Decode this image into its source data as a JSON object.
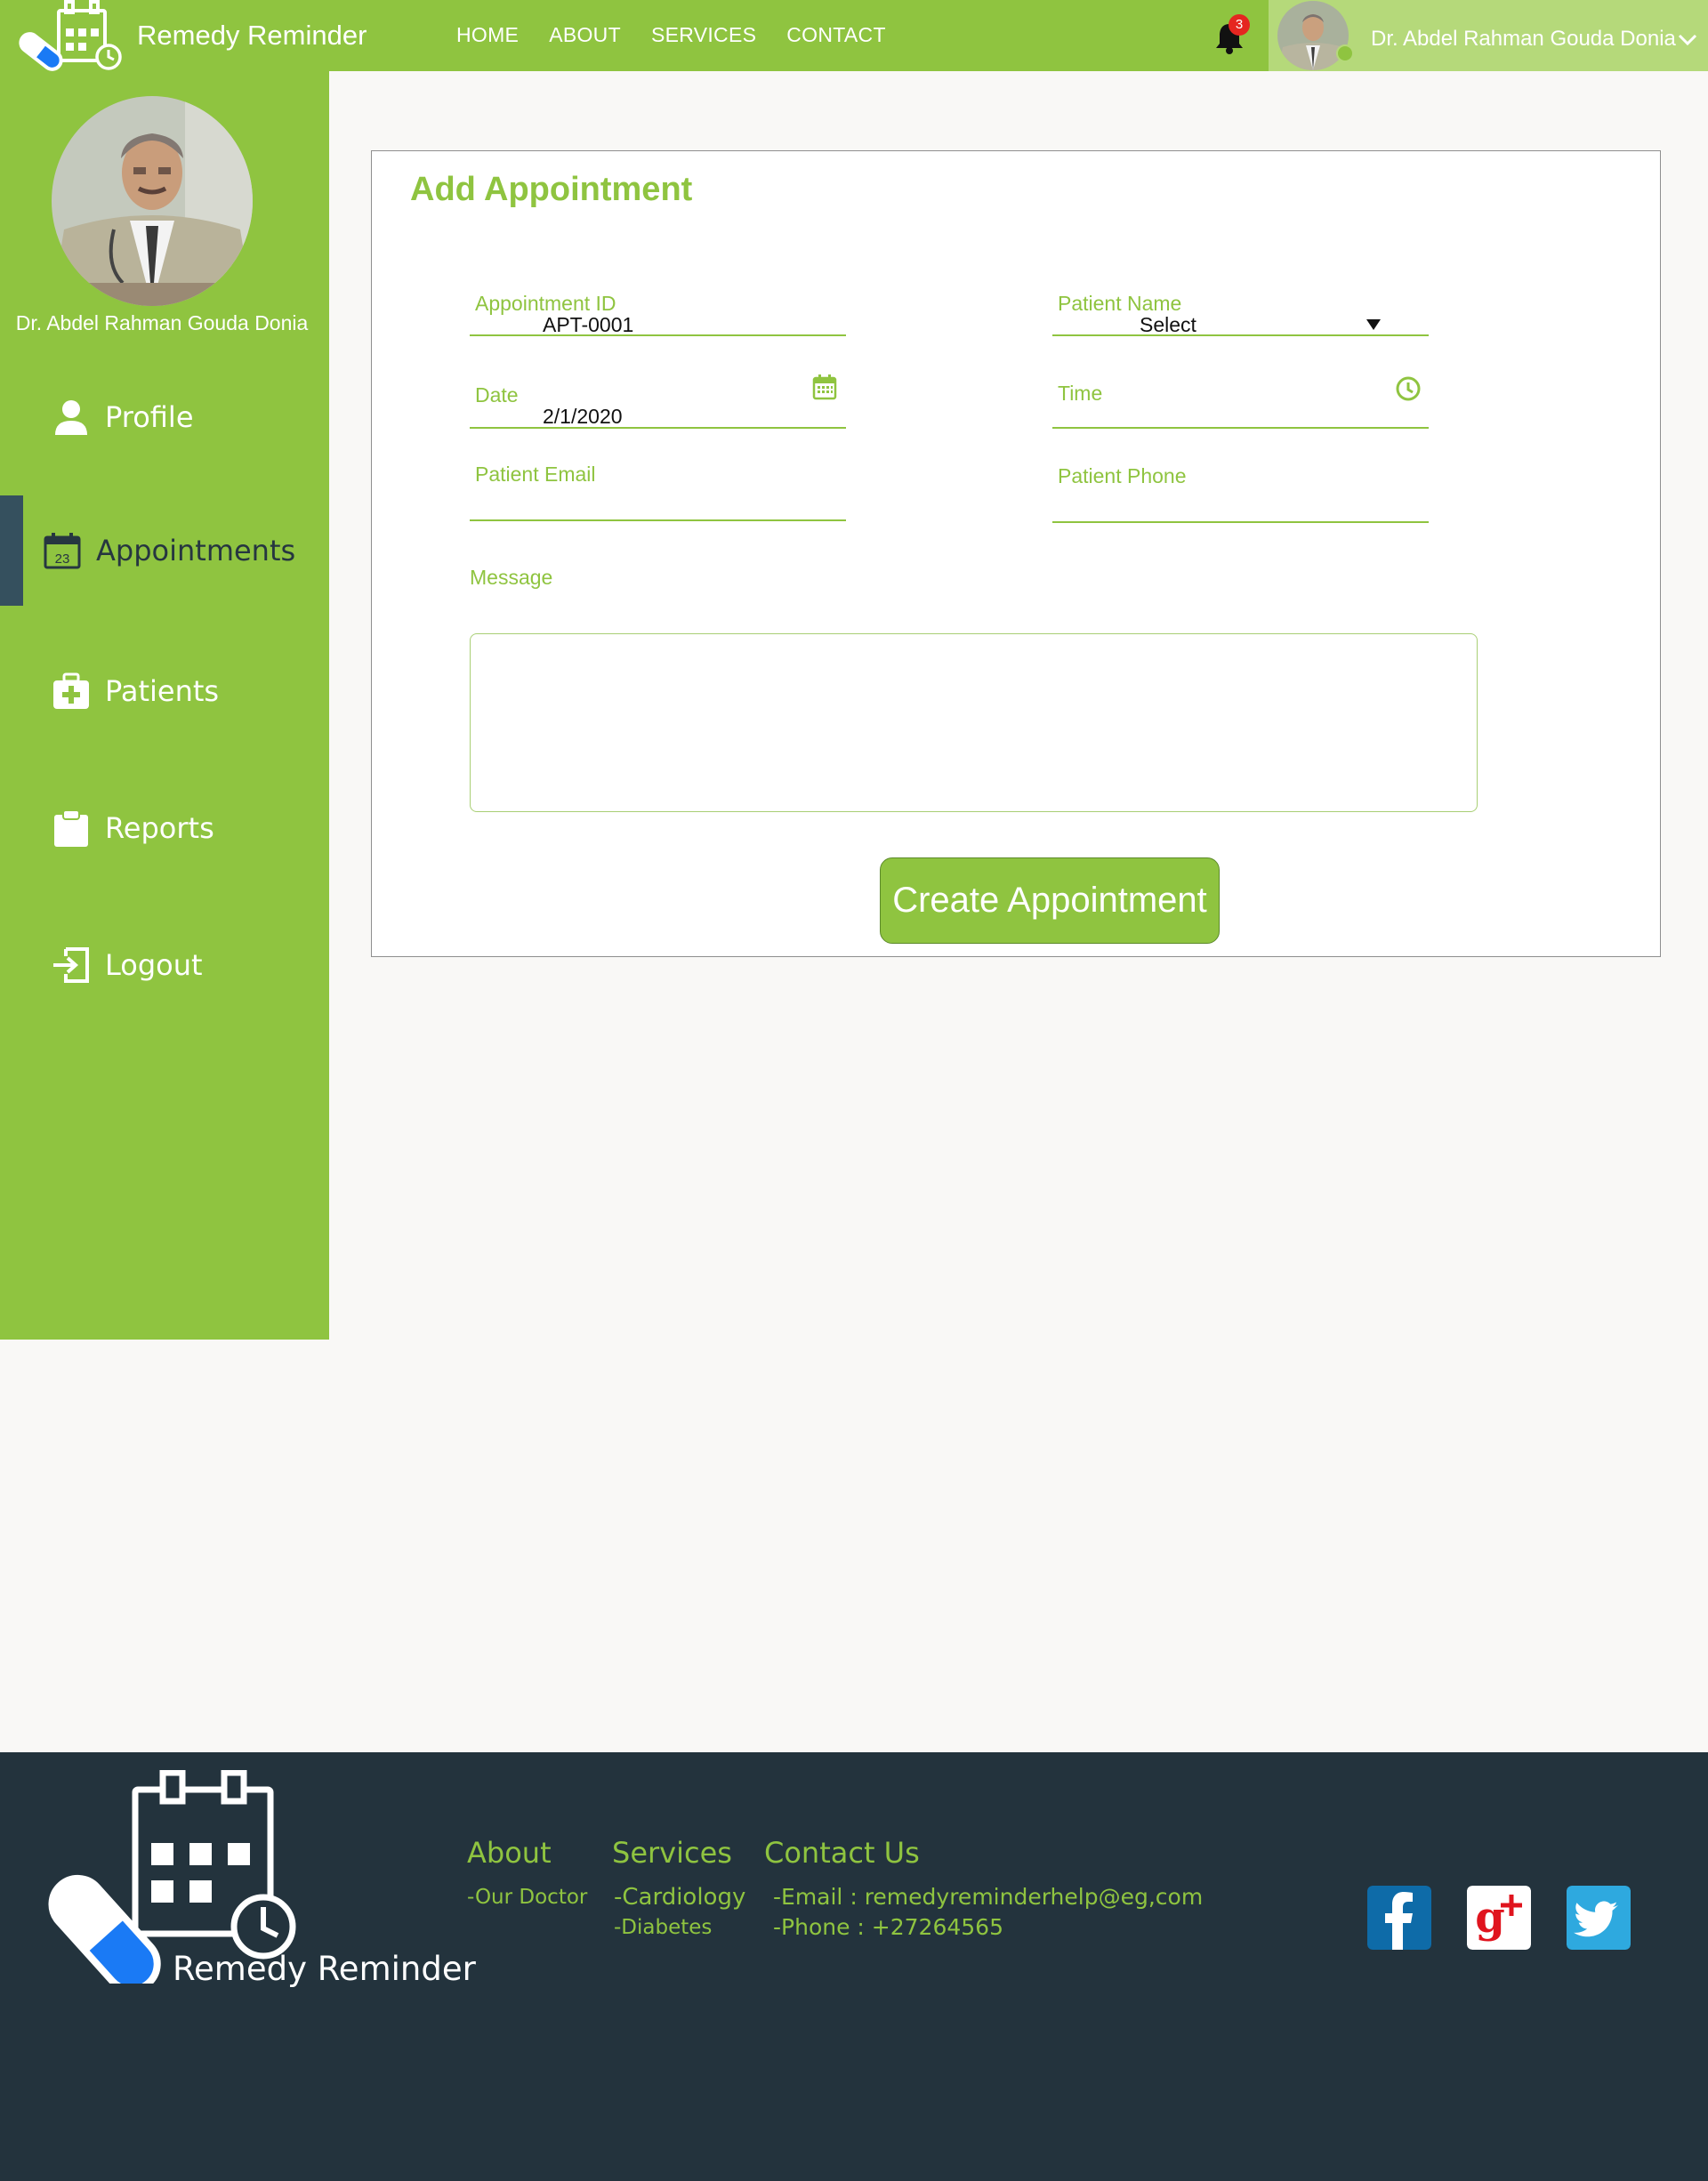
{
  "header": {
    "brand": "Remedy Reminder",
    "nav": [
      "HOME",
      "ABOUT",
      "SERVICES",
      "CONTACT"
    ],
    "notification_count": "3",
    "user_name": "Dr. Abdel Rahman Gouda Donia"
  },
  "sidebar": {
    "user_name": "Dr. Abdel Rahman Gouda Donia",
    "items": [
      {
        "label": "Profile",
        "icon": "user-icon"
      },
      {
        "label": "Appointments",
        "icon": "calendar-icon",
        "badge": "23"
      },
      {
        "label": "Patients",
        "icon": "medical-kit-icon"
      },
      {
        "label": "Reports",
        "icon": "clipboard-icon"
      },
      {
        "label": "Logout",
        "icon": "logout-icon"
      }
    ],
    "active": "Appointments"
  },
  "form": {
    "title": "Add Appointment",
    "appointment_id": {
      "label": "Appointment ID",
      "value": "APT-0001"
    },
    "patient_name": {
      "label": "Patient Name",
      "value": "Select"
    },
    "date": {
      "label": "Date",
      "value": "2/1/2020"
    },
    "time": {
      "label": "Time",
      "value": ""
    },
    "patient_email": {
      "label": "Patient Email",
      "value": ""
    },
    "patient_phone": {
      "label": "Patient Phone",
      "value": ""
    },
    "message": {
      "label": "Message",
      "value": ""
    },
    "submit": "Create Appointment"
  },
  "footer": {
    "brand": "Remedy Reminder",
    "about": {
      "title": "About",
      "items": [
        "-Our Doctor"
      ]
    },
    "services": {
      "title": "Services",
      "items": [
        "-Cardiology",
        "-Diabetes"
      ]
    },
    "contact": {
      "title": "Contact Us",
      "items": [
        "-Email : remedyreminderhelp@eg,com",
        "-Phone : +27264565"
      ]
    },
    "social": [
      "facebook-icon",
      "google-plus-icon",
      "twitter-icon"
    ]
  },
  "colors": {
    "accent": "#8fc440",
    "accent_light": "#b5d97a",
    "dark": "#23333d",
    "active_marker": "#35505e",
    "badge": "#e52620"
  }
}
